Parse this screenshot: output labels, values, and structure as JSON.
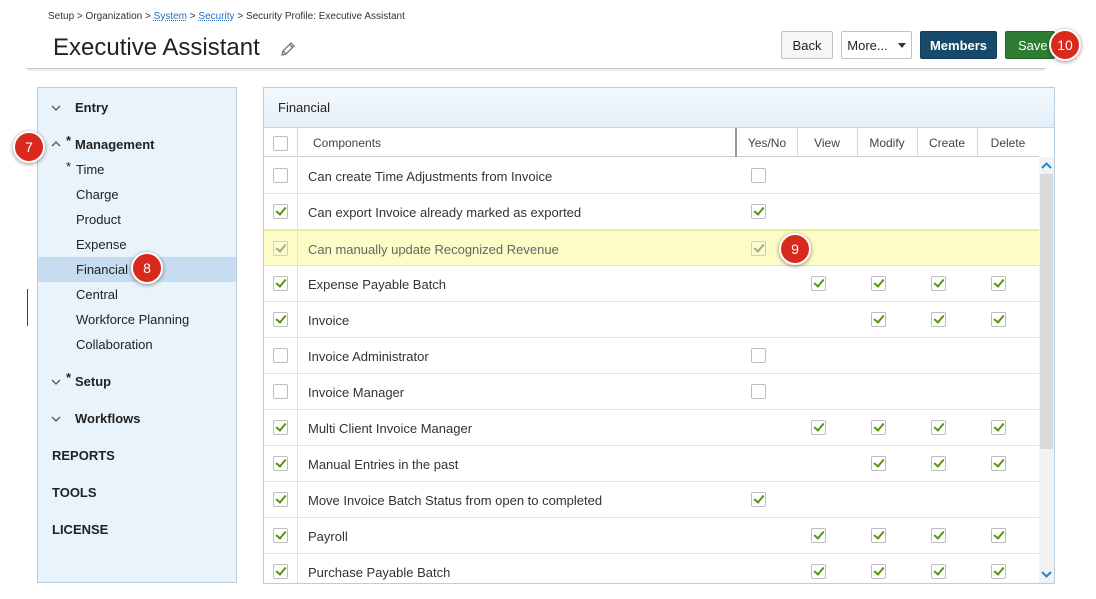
{
  "breadcrumb": {
    "setup": "Setup",
    "organization": "Organization",
    "system": "System",
    "security": "Security",
    "current": "Security Profile: Executive Assistant",
    "separator": ">"
  },
  "page": {
    "title": "Executive Assistant"
  },
  "toolbar": {
    "back_label": "Back",
    "more_label": "More...",
    "members_label": "Members",
    "save_label": "Save"
  },
  "callouts": {
    "c7": "7",
    "c8": "8",
    "c9": "9",
    "c10": "10"
  },
  "sidebar": {
    "entry": "Entry",
    "management": "Management",
    "management_items": {
      "time": "Time",
      "charge": "Charge",
      "product": "Product",
      "expense": "Expense",
      "financial": "Financial",
      "central": "Central",
      "workforce": "Workforce Planning",
      "collaboration": "Collaboration"
    },
    "setup": "Setup",
    "workflows": "Workflows",
    "reports": "REPORTS",
    "tools": "TOOLS",
    "license": "LICENSE",
    "required_marker": "*"
  },
  "panel": {
    "title": "Financial",
    "columns": {
      "components": "Components",
      "yesno": "Yes/No",
      "view": "View",
      "modify": "Modify",
      "create": "Create",
      "delete": "Delete"
    },
    "rows": [
      {
        "label": "Can create Time Adjustments from Invoice",
        "selected": false,
        "yesno": false
      },
      {
        "label": "Can export Invoice already marked as exported",
        "selected": true,
        "yesno": true
      },
      {
        "label": "Can manually update Recognized Revenue",
        "selected": true,
        "yesno": true
      },
      {
        "label": "Expense Payable Batch",
        "selected": true,
        "view": true,
        "modify": true,
        "create": true,
        "delete": true
      },
      {
        "label": "Invoice",
        "selected": true,
        "modify": true,
        "create": true,
        "delete": true
      },
      {
        "label": "Invoice Administrator",
        "selected": false,
        "yesno": false
      },
      {
        "label": "Invoice Manager",
        "selected": false,
        "yesno": false
      },
      {
        "label": "Multi Client Invoice Manager",
        "selected": true,
        "view": true,
        "modify": true,
        "create": true,
        "delete": true
      },
      {
        "label": "Manual Entries in the past",
        "selected": true,
        "modify": true,
        "create": true,
        "delete": true
      },
      {
        "label": "Move Invoice Batch Status from open to completed",
        "selected": true,
        "yesno": true
      },
      {
        "label": "Payroll",
        "selected": true,
        "view": true,
        "modify": true,
        "create": true,
        "delete": true
      },
      {
        "label": "Purchase Payable Batch",
        "selected": true,
        "view": true,
        "modify": true,
        "create": true,
        "delete": true
      }
    ]
  },
  "colors": {
    "members_bg": "#174a6a",
    "save_bg": "#2e7d32",
    "callout_bg": "#d9291c",
    "sidebar_bg": "#e9f3fb",
    "highlight_row": "#fcfcc6",
    "check_color": "#5a9216"
  }
}
